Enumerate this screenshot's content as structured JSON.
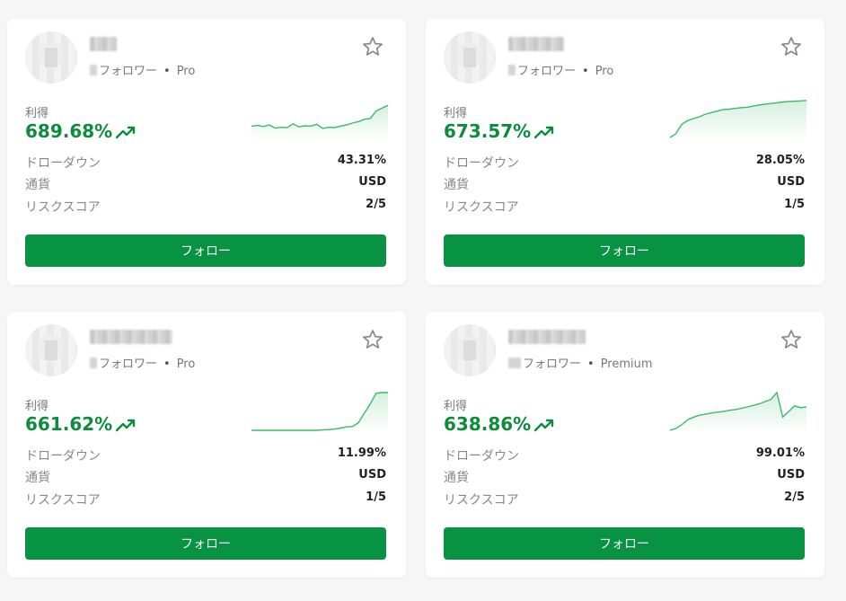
{
  "colors": {
    "accent": "#079342",
    "profit": "#0b8d3c",
    "line": "#3dba6a",
    "star": "#8a8a8a"
  },
  "cards": [
    {
      "followers_label": "フォロワー",
      "tier": "Pro",
      "profit_label": "利得",
      "profit": "689.68%",
      "rows": [
        {
          "label": "ドローダウン",
          "value": "43.31%"
        },
        {
          "label": "通貨",
          "value": "USD"
        },
        {
          "label": "リスクスコア",
          "value": "2/5"
        }
      ],
      "follow_label": "フォロー",
      "sparkline": [
        0.3,
        0.32,
        0.29,
        0.33,
        0.25,
        0.27,
        0.26,
        0.36,
        0.28,
        0.31,
        0.3,
        0.35,
        0.24,
        0.27,
        0.26,
        0.3,
        0.33,
        0.38,
        0.42,
        0.48,
        0.5,
        0.7,
        0.78,
        0.85
      ]
    },
    {
      "followers_label": "フォロワー",
      "tier": "Pro",
      "profit_label": "利得",
      "profit": "673.57%",
      "rows": [
        {
          "label": "ドローダウン",
          "value": "28.05%"
        },
        {
          "label": "通貨",
          "value": "USD"
        },
        {
          "label": "リスクスコア",
          "value": "1/5"
        }
      ],
      "follow_label": "フォロー",
      "sparkline": [
        0.0,
        0.1,
        0.35,
        0.45,
        0.5,
        0.55,
        0.62,
        0.66,
        0.7,
        0.74,
        0.75,
        0.77,
        0.79,
        0.8,
        0.83,
        0.86,
        0.88,
        0.9,
        0.92,
        0.94,
        0.95,
        0.96,
        0.97,
        0.98
      ]
    },
    {
      "followers_label": "フォロワー",
      "tier": "Pro",
      "profit_label": "利得",
      "profit": "661.62%",
      "rows": [
        {
          "label": "ドローダウン",
          "value": "11.99%"
        },
        {
          "label": "通貨",
          "value": "USD"
        },
        {
          "label": "リスクスコア",
          "value": "1/5"
        }
      ],
      "follow_label": "フォロー",
      "sparkline": [
        0.0,
        0.0,
        0.0,
        0.0,
        0.0,
        0.0,
        0.0,
        0.0,
        0.0,
        0.0,
        0.0,
        0.0,
        0.01,
        0.02,
        0.03,
        0.06,
        0.09,
        0.1,
        0.2,
        0.45,
        0.7,
        0.98,
        1.0,
        1.0
      ]
    },
    {
      "followers_label": "フォロワー",
      "tier": "Premium",
      "profit_label": "利得",
      "profit": "638.86%",
      "rows": [
        {
          "label": "ドローダウン",
          "value": "99.01%"
        },
        {
          "label": "通貨",
          "value": "USD"
        },
        {
          "label": "リスクスコア",
          "value": "2/5"
        }
      ],
      "follow_label": "フォロー",
      "sparkline": [
        0.0,
        0.05,
        0.15,
        0.28,
        0.35,
        0.4,
        0.43,
        0.46,
        0.48,
        0.5,
        0.53,
        0.55,
        0.58,
        0.62,
        0.66,
        0.7,
        0.76,
        0.82,
        1.0,
        0.35,
        0.5,
        0.65,
        0.6,
        0.62
      ]
    }
  ]
}
